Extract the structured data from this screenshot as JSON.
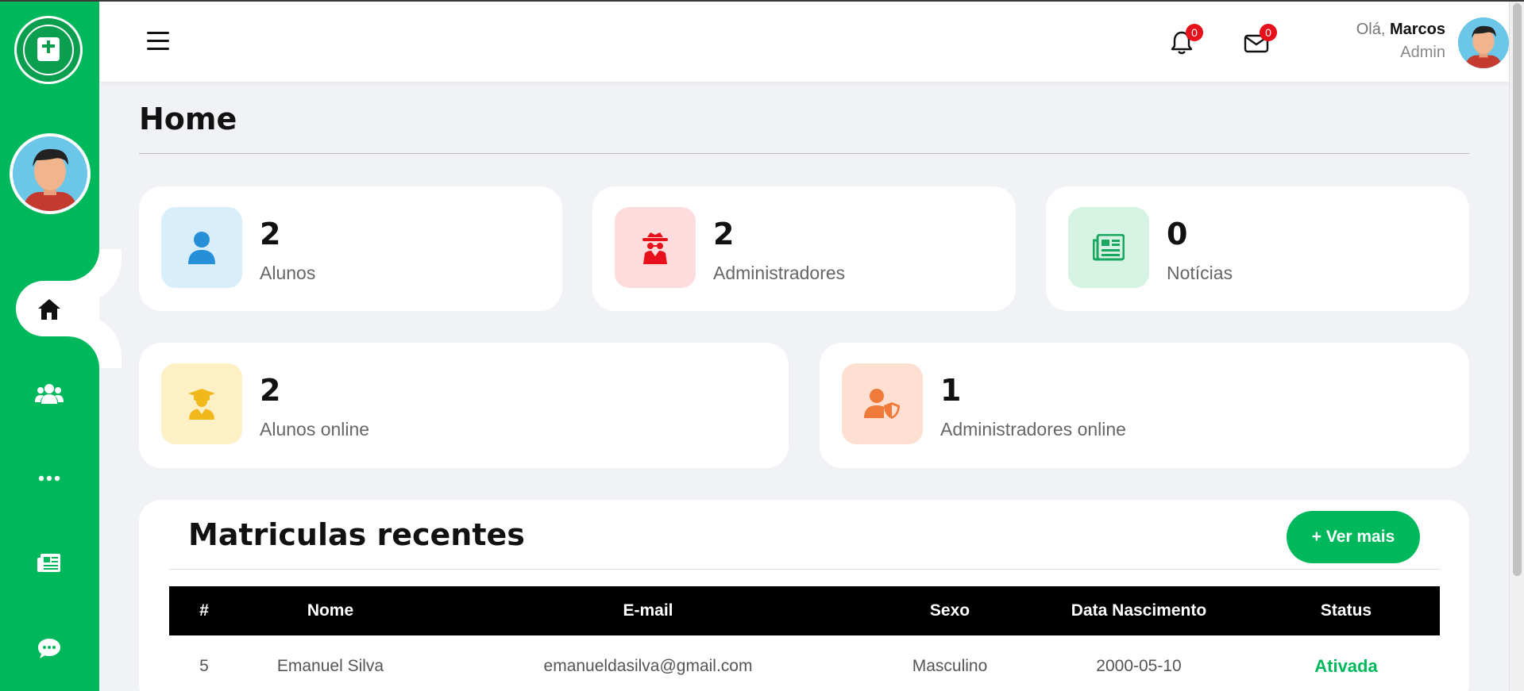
{
  "header": {
    "notifications_count": "0",
    "messages_count": "0",
    "greeting_prefix": "Olá,",
    "user_name": "Marcos",
    "user_role": "Admin"
  },
  "page": {
    "title": "Home"
  },
  "stats": [
    {
      "value": "2",
      "label": "Alunos",
      "icon": "user-icon",
      "color": "#2590d8"
    },
    {
      "value": "2",
      "label": "Administradores",
      "icon": "spy-icon",
      "color": "#e8101a"
    },
    {
      "value": "0",
      "label": "Notícias",
      "icon": "newspaper-icon",
      "color": "#1aa760"
    },
    {
      "value": "2",
      "label": "Alunos online",
      "icon": "graduate-icon",
      "color": "#f0b81a"
    },
    {
      "value": "1",
      "label": "Administradores online",
      "icon": "user-shield-icon",
      "color": "#f07a3a"
    }
  ],
  "sidebar": {
    "items": [
      {
        "name": "home",
        "icon": "home-icon",
        "active": true
      },
      {
        "name": "users",
        "icon": "users-icon"
      },
      {
        "name": "more",
        "icon": "ellipsis-icon"
      },
      {
        "name": "news",
        "icon": "newspaper-icon"
      },
      {
        "name": "chat",
        "icon": "chat-icon"
      }
    ]
  },
  "enrollments": {
    "title": "Matriculas recentes",
    "button_label": "+ Ver mais",
    "columns": [
      "#",
      "Nome",
      "E-mail",
      "Sexo",
      "Data Nascimento",
      "Status"
    ],
    "rows": [
      [
        "5",
        "Emanuel Silva",
        "emanueldasilva@gmail.com",
        "Masculino",
        "2000-05-10",
        "Ativada"
      ]
    ]
  },
  "colors": {
    "brand": "#00b85c",
    "status_active": "#00b85c",
    "badge": "#e8101a"
  }
}
